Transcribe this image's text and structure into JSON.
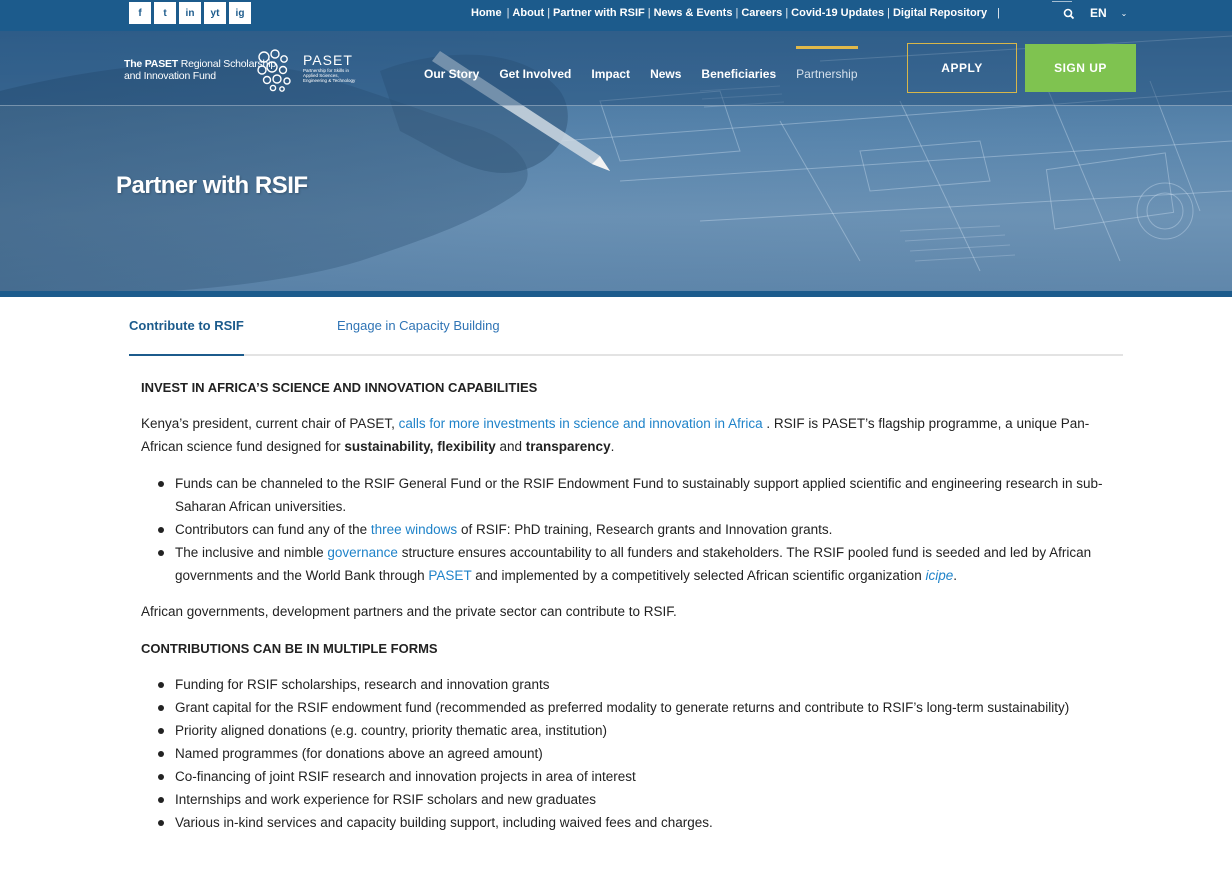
{
  "social": [
    "f",
    "t",
    "in",
    "yt",
    "ig"
  ],
  "top_nav": {
    "items": [
      "Home",
      "About",
      "Partner with RSIF",
      "News & Events",
      "Careers",
      "Covid-19 Updates",
      "Digital Repository"
    ],
    "separator": "|"
  },
  "language": {
    "label": "EN",
    "chevron": "⌄"
  },
  "logo": {
    "text_line1_bold": "The PASET",
    "text_line1": "Regional Scholarship",
    "text_line2": "and Innovation Fund",
    "brand": "PASET",
    "brand_sub": "Partnership for Skills in Applied Sciences, Engineering & Technology"
  },
  "main_nav": {
    "items": [
      "Our Story",
      "Get Involved",
      "Impact",
      "News",
      "Beneficiaries",
      "Partnership"
    ],
    "active": "Partnership"
  },
  "buttons": {
    "apply": "APPLY",
    "signup": "SIGN UP"
  },
  "hero": {
    "title": "Partner with RSIF"
  },
  "tabs": {
    "active": "Contribute to RSIF",
    "other": "Engage in Capacity Building"
  },
  "content": {
    "heading1": "INVEST IN AFRICA’S SCIENCE AND INNOVATION CAPABILITIES",
    "p1_a": "Kenya’s president, current chair of PASET,",
    "p1_link": "calls for more investments in science and innovation in Africa",
    "p1_b": ". RSIF is PASET’s flagship programme, a unique Pan-African science fund designed for",
    "p1_bold1": "sustainability",
    "p1_comma": ",",
    "p1_bold2": "flexibility",
    "p1_and": "and",
    "p1_bold3": "transparency",
    "p1_end": ".",
    "b1": "Funds can be channeled to the RSIF General Fund or the RSIF Endowment Fund to sustainably support applied scientific and engineering research in sub-Saharan African universities.",
    "b2_a": "Contributors can fund any of the",
    "b2_link": "three windows",
    "b2_b": "of RSIF: PhD training, Research grants and Innovation grants.",
    "b3_a": "The inclusive and nimble",
    "b3_link": "governance",
    "b3_b": "structure ensures accountability to all funders and stakeholders.  The RSIF pooled fund is seeded and led by African governments and the World Bank through",
    "b3_link2": "PASET",
    "b3_c": "and implemented by a competitively selected African scientific organization",
    "b3_link3": "icipe",
    "b3_end": ".",
    "p2": "African governments, development partners and the private sector can contribute to RSIF.",
    "heading2": "CONTRIBUTIONS CAN BE IN MULTIPLE FORMS",
    "forms": [
      "Funding for RSIF scholarships, research and innovation grants",
      "Grant capital for the RSIF endowment fund (recommended as preferred modality to generate returns and contribute to RSIF’s long-term sustainability)",
      "Priority aligned donations (e.g. country, priority thematic area, institution)",
      "Named programmes (for donations above an agreed amount)",
      "Co-financing of joint RSIF research and innovation projects in area of interest",
      "Internships and work experience for RSIF scholars and new graduates",
      "Various in-kind services and capacity building support, including waived fees and charges."
    ]
  },
  "colors": {
    "brand_blue": "#1c5b8c",
    "gold": "#d7b64a",
    "green": "#7fc350",
    "link": "#1f83c9"
  }
}
